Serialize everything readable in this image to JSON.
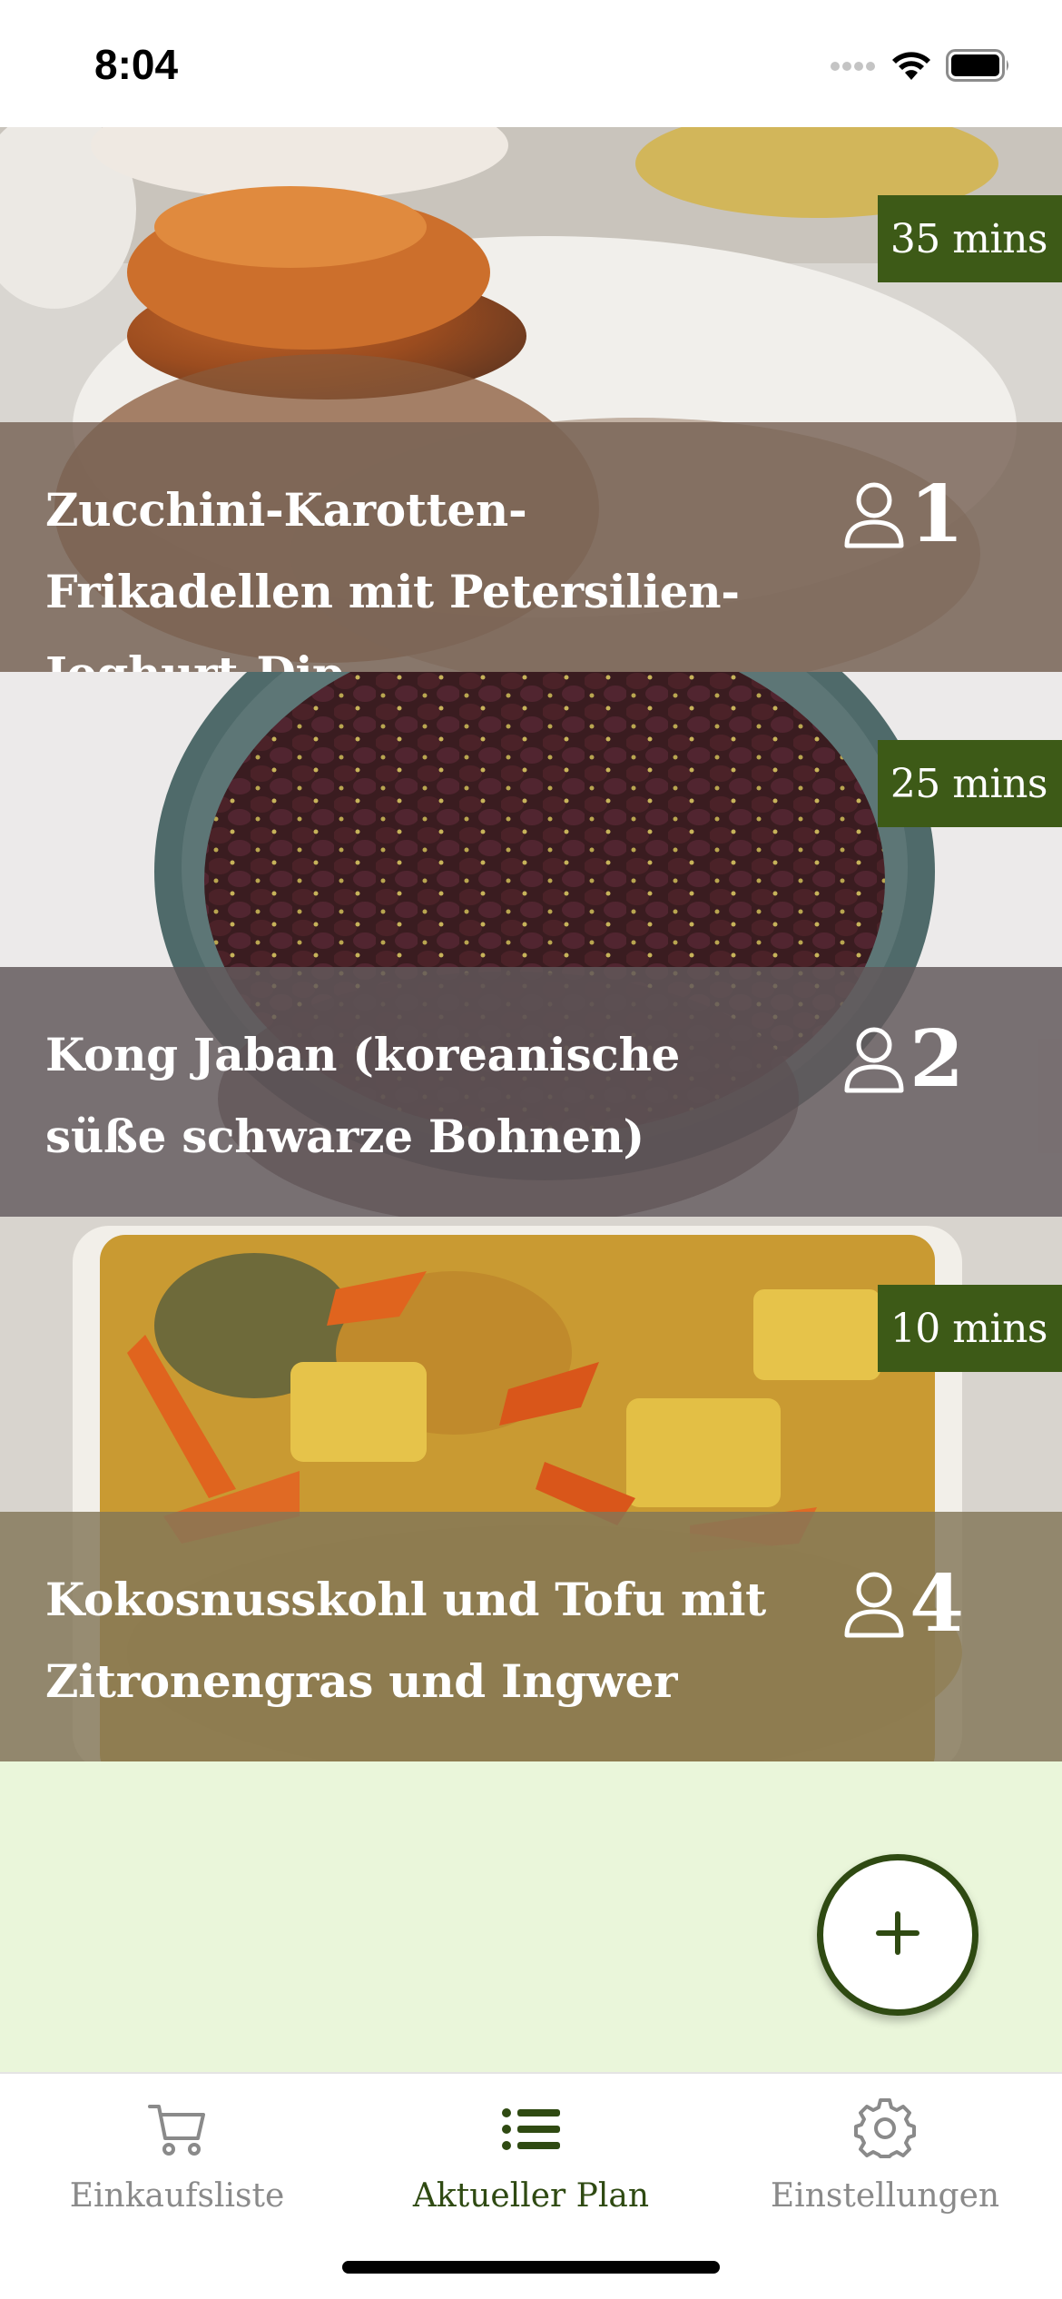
{
  "status_bar": {
    "time": "8:04",
    "icons": [
      "signal-icon",
      "wifi-icon",
      "battery-icon"
    ]
  },
  "recipes": [
    {
      "title": "Zucchini-Karotten-Frikadellen mit Petersilien-Joghurt-Dip",
      "time": "35 mins",
      "servings": "1",
      "image": "zucchini-carrot-fritters-photo"
    },
    {
      "title": "Kong Jaban (koreanische süße schwarze Bohnen)",
      "time": "25 mins",
      "servings": "2",
      "image": "black-beans-bowl-photo"
    },
    {
      "title": "Kokosnusskohl und Tofu mit Zitronengras und Ingwer",
      "time": "10 mins",
      "servings": "4",
      "image": "coconut-cabbage-tofu-photo"
    }
  ],
  "fab": {
    "icon": "plus-icon"
  },
  "tab_bar": {
    "tabs": [
      {
        "label": "Einkaufsliste",
        "icon": "cart-icon",
        "active": false
      },
      {
        "label": "Aktueller Plan",
        "icon": "list-icon",
        "active": true
      },
      {
        "label": "Einstellungen",
        "icon": "gear-icon",
        "active": false
      }
    ]
  },
  "colors": {
    "accent": "#3d5a17",
    "active_tab": "#2f4a12",
    "inactive_tab": "#8a8a8a",
    "empty_background": "#eaf6da"
  }
}
